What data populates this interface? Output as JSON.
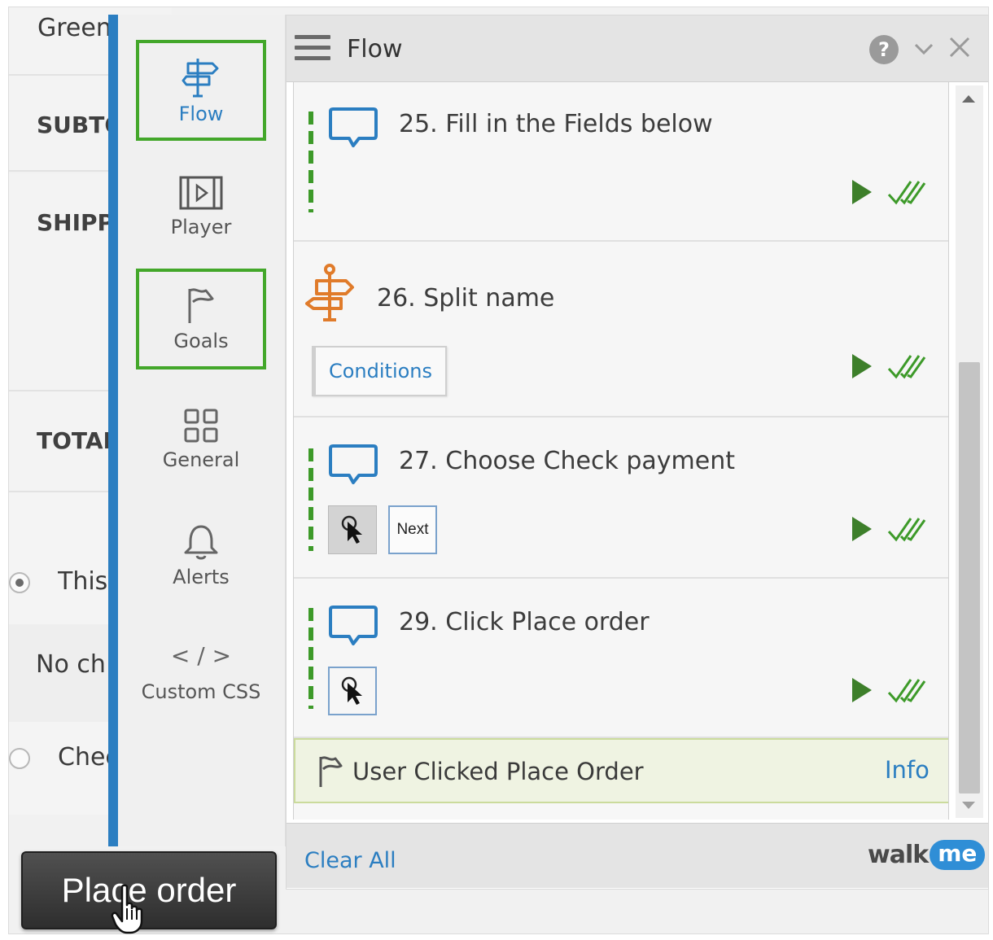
{
  "background_page": {
    "rows": [
      {
        "label": "Green"
      },
      {
        "label": "SUBTOTAL"
      },
      {
        "label": "SHIPPING"
      },
      {
        "label": "TOTAL"
      }
    ],
    "payment_options": [
      {
        "label": "This",
        "checked": true
      },
      {
        "label": "No ch"
      },
      {
        "label": "Chec",
        "checked": false
      }
    ],
    "place_order_label": "Place order"
  },
  "sidebar": {
    "items": [
      {
        "label": "Flow",
        "icon": "signpost-icon",
        "active": true,
        "highlighted": true
      },
      {
        "label": "Player",
        "icon": "player-icon"
      },
      {
        "label": "Goals",
        "icon": "flag-icon",
        "highlighted": true
      },
      {
        "label": "General",
        "icon": "grid-icon"
      },
      {
        "label": "Alerts",
        "icon": "bell-icon"
      },
      {
        "label": "Custom CSS",
        "icon": "code-icon",
        "icon_text": "< / >"
      }
    ]
  },
  "header": {
    "title": "Flow",
    "help_icon_text": "?"
  },
  "steps": [
    {
      "title": "25. Fill in the Fields below",
      "icon": "speech-bubble-icon"
    },
    {
      "title": "26. Split name",
      "icon": "split-signpost-icon",
      "button": "Conditions"
    },
    {
      "title": "27. Choose Check payment",
      "icon": "speech-bubble-icon",
      "button": "Next"
    },
    {
      "title": "29. Click Place order",
      "icon": "speech-bubble-icon"
    }
  ],
  "goal": {
    "label": "User Clicked Place Order",
    "info": "Info"
  },
  "footer": {
    "clear_all": "Clear All",
    "logo_walk": "walk",
    "logo_me": "me"
  },
  "colors": {
    "accent_blue": "#2b7ec1",
    "highlight_green": "#43a72a",
    "step_bar_green": "#3d9a29",
    "split_orange": "#e07b2a"
  }
}
